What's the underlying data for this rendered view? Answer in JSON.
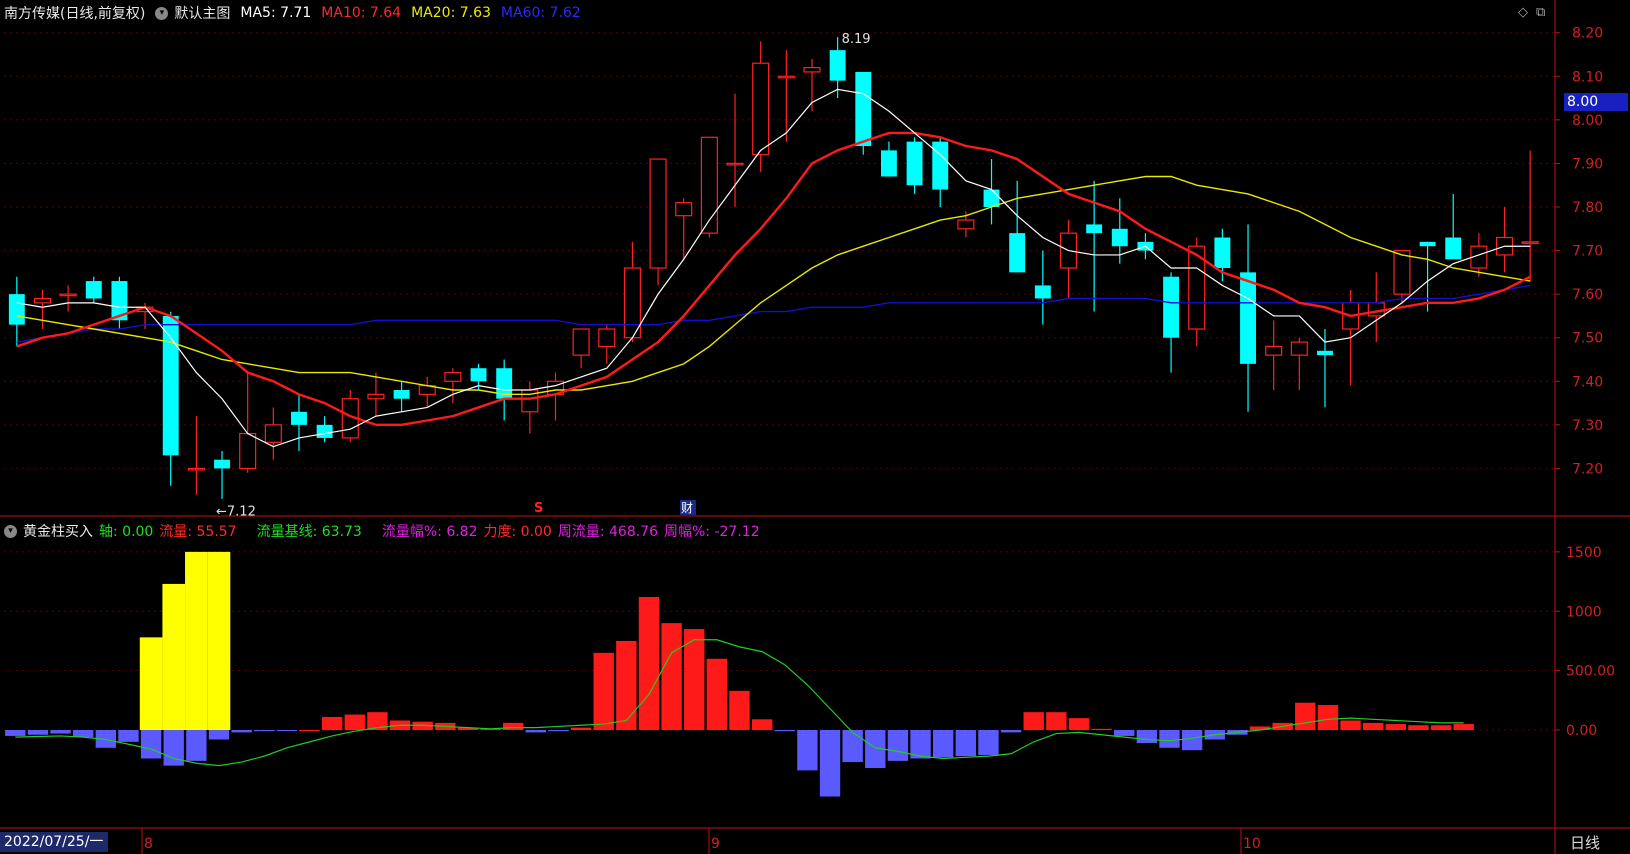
{
  "header": {
    "stock": "南方传媒(日线,前复权)",
    "template_label": "默认主图",
    "ma5": "MA5: 7.71",
    "ma10": "MA10: 7.64",
    "ma20": "MA20: 7.63",
    "ma60": "MA60: 7.62"
  },
  "indicator_header": {
    "name": "黄金柱买入",
    "axis": "轴: 0.00",
    "flow": "流量: 55.57",
    "baseline": "流量基线: 63.73",
    "flow_amp": "流量幅%: 6.82",
    "force": "力度: 0.00",
    "week_flow": "周流量: 468.76",
    "week_amp": "周幅%: -27.12"
  },
  "footer": {
    "date": "2022/07/25/一",
    "period": "日线"
  },
  "current_price": "8.00",
  "markers": {
    "high": "8.19",
    "low": "←7.12",
    "event_s": "S",
    "event_cai": "财"
  },
  "colors": {
    "up": "#ff2020",
    "down": "#00ffff",
    "ma5": "#ffffff",
    "ma10": "#ff1a1a",
    "ma20": "#e8e800",
    "ma60": "#1010d0",
    "bars_up": "#ff1a1a",
    "bars_down": "#5a5aff",
    "gold": "#ffff00",
    "flow_line": "#22cc22",
    "axis": "#c01010"
  },
  "chart_data": [
    {
      "type": "candlestick",
      "title": "南方传媒(日线,前复权)",
      "y_ticks": [
        "8.20",
        "8.10",
        "8.00",
        "7.90",
        "7.80",
        "7.70",
        "7.60",
        "7.50",
        "7.40",
        "7.30",
        "7.20"
      ],
      "ylim": [
        7.1,
        8.22
      ],
      "x_labels": [
        "8",
        "9",
        "10"
      ],
      "ohlc": [
        [
          7.6,
          7.64,
          7.48,
          7.53
        ],
        [
          7.58,
          7.61,
          7.52,
          7.59
        ],
        [
          7.6,
          7.62,
          7.56,
          7.6
        ],
        [
          7.63,
          7.64,
          7.58,
          7.59
        ],
        [
          7.63,
          7.64,
          7.52,
          7.54
        ],
        [
          7.56,
          7.58,
          7.52,
          7.57
        ],
        [
          7.55,
          7.56,
          7.16,
          7.23
        ],
        [
          7.2,
          7.32,
          7.14,
          7.2
        ],
        [
          7.22,
          7.24,
          7.13,
          7.2
        ],
        [
          7.2,
          7.42,
          7.19,
          7.28
        ],
        [
          7.26,
          7.34,
          7.22,
          7.3
        ],
        [
          7.33,
          7.37,
          7.24,
          7.3
        ],
        [
          7.3,
          7.32,
          7.26,
          7.27
        ],
        [
          7.27,
          7.38,
          7.26,
          7.36
        ],
        [
          7.36,
          7.42,
          7.32,
          7.37
        ],
        [
          7.38,
          7.4,
          7.33,
          7.36
        ],
        [
          7.37,
          7.41,
          7.34,
          7.39
        ],
        [
          7.4,
          7.43,
          7.35,
          7.42
        ],
        [
          7.43,
          7.44,
          7.38,
          7.4
        ],
        [
          7.43,
          7.45,
          7.31,
          7.36
        ],
        [
          7.33,
          7.4,
          7.28,
          7.38
        ],
        [
          7.37,
          7.42,
          7.31,
          7.4
        ],
        [
          7.46,
          7.52,
          7.43,
          7.52
        ],
        [
          7.48,
          7.53,
          7.44,
          7.52
        ],
        [
          7.5,
          7.72,
          7.49,
          7.66
        ],
        [
          7.66,
          7.91,
          7.62,
          7.91
        ],
        [
          7.78,
          7.82,
          7.68,
          7.81
        ],
        [
          7.74,
          7.92,
          7.73,
          7.96
        ],
        [
          7.9,
          8.06,
          7.8,
          7.9
        ],
        [
          7.92,
          8.18,
          7.88,
          8.13
        ],
        [
          8.1,
          8.16,
          7.95,
          8.1
        ],
        [
          8.11,
          8.14,
          8.02,
          8.12
        ],
        [
          8.16,
          8.19,
          8.05,
          8.09
        ],
        [
          8.11,
          8.11,
          7.92,
          7.94
        ],
        [
          7.93,
          7.95,
          7.88,
          7.87
        ],
        [
          7.95,
          7.96,
          7.83,
          7.85
        ],
        [
          7.95,
          7.96,
          7.8,
          7.84
        ],
        [
          7.75,
          7.79,
          7.73,
          7.77
        ],
        [
          7.84,
          7.91,
          7.76,
          7.8
        ],
        [
          7.74,
          7.86,
          7.66,
          7.65
        ],
        [
          7.62,
          7.7,
          7.53,
          7.59
        ],
        [
          7.66,
          7.77,
          7.59,
          7.74
        ],
        [
          7.76,
          7.86,
          7.56,
          7.74
        ],
        [
          7.75,
          7.82,
          7.67,
          7.71
        ],
        [
          7.72,
          7.74,
          7.68,
          7.7
        ],
        [
          7.64,
          7.65,
          7.42,
          7.5
        ],
        [
          7.52,
          7.73,
          7.48,
          7.71
        ],
        [
          7.73,
          7.75,
          7.63,
          7.66
        ],
        [
          7.65,
          7.76,
          7.33,
          7.44
        ],
        [
          7.46,
          7.54,
          7.38,
          7.48
        ],
        [
          7.46,
          7.5,
          7.38,
          7.49
        ],
        [
          7.47,
          7.52,
          7.34,
          7.46
        ],
        [
          7.52,
          7.61,
          7.39,
          7.58
        ],
        [
          7.55,
          7.65,
          7.49,
          7.58
        ],
        [
          7.6,
          7.7,
          7.58,
          7.7
        ],
        [
          7.72,
          7.72,
          7.56,
          7.71
        ],
        [
          7.73,
          7.83,
          7.68,
          7.68
        ],
        [
          7.66,
          7.74,
          7.64,
          7.71
        ],
        [
          7.69,
          7.8,
          7.65,
          7.73
        ],
        [
          7.72,
          7.93,
          7.63,
          7.72
        ]
      ],
      "ma5": [
        7.58,
        7.57,
        7.58,
        7.58,
        7.57,
        7.57,
        7.5,
        7.42,
        7.36,
        7.28,
        7.25,
        7.27,
        7.28,
        7.29,
        7.32,
        7.33,
        7.34,
        7.37,
        7.39,
        7.38,
        7.38,
        7.39,
        7.41,
        7.43,
        7.5,
        7.6,
        7.68,
        7.77,
        7.85,
        7.93,
        7.97,
        8.04,
        8.07,
        8.06,
        8.02,
        7.97,
        7.92,
        7.86,
        7.84,
        7.78,
        7.73,
        7.7,
        7.69,
        7.69,
        7.71,
        7.66,
        7.66,
        7.62,
        7.59,
        7.55,
        7.55,
        7.49,
        7.5,
        7.54,
        7.58,
        7.63,
        7.67,
        7.69,
        7.71,
        7.71
      ],
      "ma10": [
        7.48,
        7.5,
        7.51,
        7.53,
        7.55,
        7.57,
        7.55,
        7.51,
        7.47,
        7.42,
        7.4,
        7.37,
        7.35,
        7.32,
        7.3,
        7.3,
        7.31,
        7.32,
        7.34,
        7.36,
        7.36,
        7.37,
        7.39,
        7.41,
        7.45,
        7.49,
        7.55,
        7.62,
        7.69,
        7.75,
        7.82,
        7.9,
        7.93,
        7.95,
        7.97,
        7.97,
        7.96,
        7.94,
        7.93,
        7.91,
        7.87,
        7.83,
        7.81,
        7.79,
        7.75,
        7.72,
        7.69,
        7.65,
        7.63,
        7.61,
        7.58,
        7.57,
        7.55,
        7.56,
        7.57,
        7.58,
        7.58,
        7.59,
        7.61,
        7.64
      ],
      "ma20": [
        7.55,
        7.54,
        7.53,
        7.52,
        7.51,
        7.5,
        7.49,
        7.47,
        7.45,
        7.44,
        7.43,
        7.42,
        7.42,
        7.42,
        7.41,
        7.4,
        7.39,
        7.38,
        7.38,
        7.37,
        7.37,
        7.38,
        7.38,
        7.39,
        7.4,
        7.42,
        7.44,
        7.48,
        7.53,
        7.58,
        7.62,
        7.66,
        7.69,
        7.71,
        7.73,
        7.75,
        7.77,
        7.78,
        7.8,
        7.82,
        7.83,
        7.84,
        7.85,
        7.86,
        7.87,
        7.87,
        7.85,
        7.84,
        7.83,
        7.81,
        7.79,
        7.76,
        7.73,
        7.71,
        7.69,
        7.68,
        7.66,
        7.65,
        7.64,
        7.63
      ],
      "ma60": [
        7.49,
        7.5,
        7.51,
        7.52,
        7.52,
        7.53,
        7.53,
        7.53,
        7.53,
        7.53,
        7.53,
        7.53,
        7.53,
        7.53,
        7.54,
        7.54,
        7.54,
        7.54,
        7.54,
        7.54,
        7.54,
        7.54,
        7.53,
        7.53,
        7.53,
        7.53,
        7.54,
        7.54,
        7.55,
        7.56,
        7.56,
        7.57,
        7.57,
        7.57,
        7.58,
        7.58,
        7.58,
        7.58,
        7.58,
        7.58,
        7.58,
        7.59,
        7.59,
        7.59,
        7.59,
        7.58,
        7.58,
        7.58,
        7.58,
        7.58,
        7.58,
        7.58,
        7.58,
        7.58,
        7.59,
        7.59,
        7.59,
        7.6,
        7.61,
        7.62
      ]
    },
    {
      "type": "bar",
      "title": "黄金柱买入",
      "y_ticks": [
        "1500",
        "1000",
        "500.00",
        "0.00"
      ],
      "ylim": [
        -800,
        1600
      ],
      "values": [
        -50,
        -40,
        -30,
        -60,
        -150,
        -100,
        -240,
        -300,
        -260,
        -80,
        -20,
        -10,
        -5,
        0,
        110,
        130,
        150,
        80,
        70,
        60,
        20,
        10,
        60,
        -20,
        -10,
        20,
        650,
        750,
        1120,
        900,
        850,
        600,
        330,
        90,
        -10,
        -340,
        -560,
        -270,
        -320,
        -260,
        -240,
        -230,
        -220,
        -210,
        -20,
        150,
        150,
        100,
        10,
        -50,
        -110,
        -150,
        -170,
        -80,
        -40,
        30,
        60,
        230,
        210,
        80,
        60,
        50,
        40,
        40,
        50
      ],
      "gold": [
        0,
        0,
        0,
        0,
        0,
        0,
        780,
        1230,
        1500,
        1500,
        0
      ],
      "flow_line": [
        -60,
        -55,
        -50,
        -60,
        -80,
        -120,
        -160,
        -240,
        -280,
        -300,
        -270,
        -220,
        -150,
        -100,
        -50,
        -10,
        20,
        40,
        40,
        30,
        20,
        10,
        20,
        20,
        30,
        40,
        50,
        80,
        300,
        650,
        760,
        760,
        700,
        660,
        550,
        380,
        180,
        -20,
        -150,
        -180,
        -220,
        -240,
        -230,
        -220,
        -200,
        -100,
        -30,
        -20,
        -40,
        -60,
        -80,
        -90,
        -70,
        -40,
        -20,
        0,
        30,
        60,
        90,
        100,
        90,
        80,
        70,
        60,
        60
      ]
    }
  ]
}
